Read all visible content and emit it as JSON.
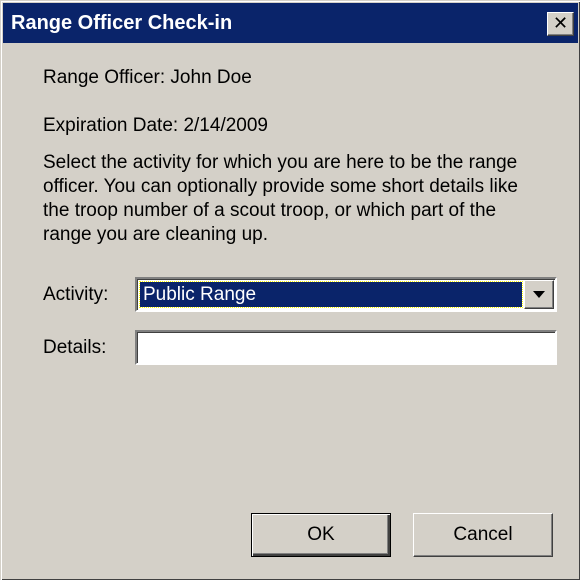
{
  "window": {
    "title": "Range Officer Check-in",
    "close_glyph": "✕"
  },
  "info": {
    "officer": "Range Officer: John Doe",
    "expiration": "Expiration Date: 2/14/2009"
  },
  "description": "Select the activity for which you are here to be the range officer. You can optionally provide some short details like the troop number of a scout troop, or which part of the range you are cleaning up.",
  "form": {
    "activity_label": "Activity:",
    "activity_value": "Public Range",
    "details_label": "Details:",
    "details_value": ""
  },
  "buttons": {
    "ok": "OK",
    "cancel": "Cancel"
  },
  "colors": {
    "titlebar": "#0a246a",
    "dialog_bg": "#d4d0c8",
    "selection": "#0a246a"
  }
}
